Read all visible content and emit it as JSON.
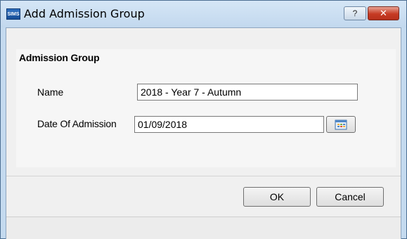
{
  "window": {
    "title": "Add Admission Group",
    "app_icon_text": "SIMS",
    "help_label": "?",
    "close_label": "✕"
  },
  "group": {
    "title": "Admission Group",
    "name_label": "Name",
    "name_value": "2018 - Year 7 - Autumn",
    "date_label": "Date Of Admission",
    "date_value": "01/09/2018"
  },
  "buttons": {
    "ok_label": "OK",
    "cancel_label": "Cancel"
  },
  "colors": {
    "title_bar": "#c4daef",
    "close_button": "#c63a23"
  }
}
